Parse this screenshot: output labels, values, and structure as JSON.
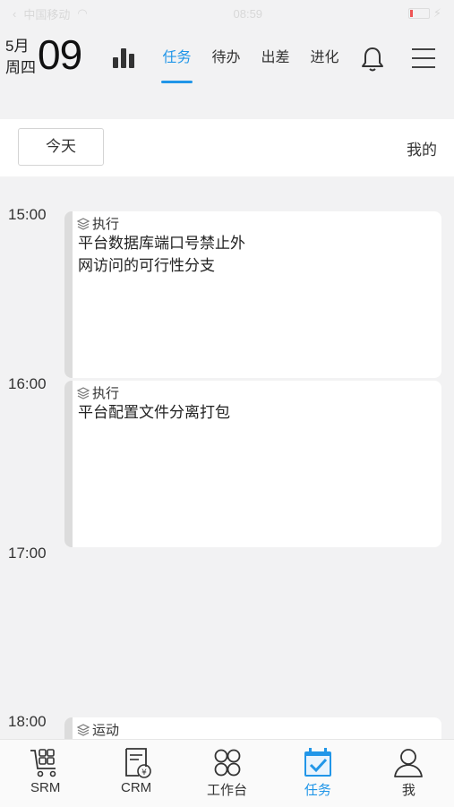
{
  "status_bar": {
    "carrier": "中国移动",
    "time": "08:59"
  },
  "header": {
    "month": "5月",
    "weekday": "周四",
    "day": "09",
    "tabs": [
      {
        "label": "任务",
        "active": true
      },
      {
        "label": "待办",
        "active": false
      },
      {
        "label": "出差",
        "active": false
      },
      {
        "label": "进化",
        "active": false
      }
    ]
  },
  "filter": {
    "today_label": "今天",
    "mine_label": "我的"
  },
  "timeline": {
    "times": [
      "15:00",
      "16:00",
      "17:00",
      "18:00"
    ],
    "events": [
      {
        "tag": "执行",
        "title": "平台数据库端口号禁止外网访问的可行性分支"
      },
      {
        "tag": "执行",
        "title": "平台配置文件分离打包"
      },
      {
        "tag": "运动",
        "title": ""
      }
    ]
  },
  "tabbar": {
    "items": [
      {
        "label": "SRM",
        "icon": "cart-icon"
      },
      {
        "label": "CRM",
        "icon": "invoice-icon"
      },
      {
        "label": "工作台",
        "icon": "grid-icon"
      },
      {
        "label": "任务",
        "icon": "calendar-check-icon",
        "active": true
      },
      {
        "label": "我",
        "icon": "person-icon"
      }
    ]
  },
  "colors": {
    "accent": "#2196e8",
    "background": "#f2f2f3"
  }
}
